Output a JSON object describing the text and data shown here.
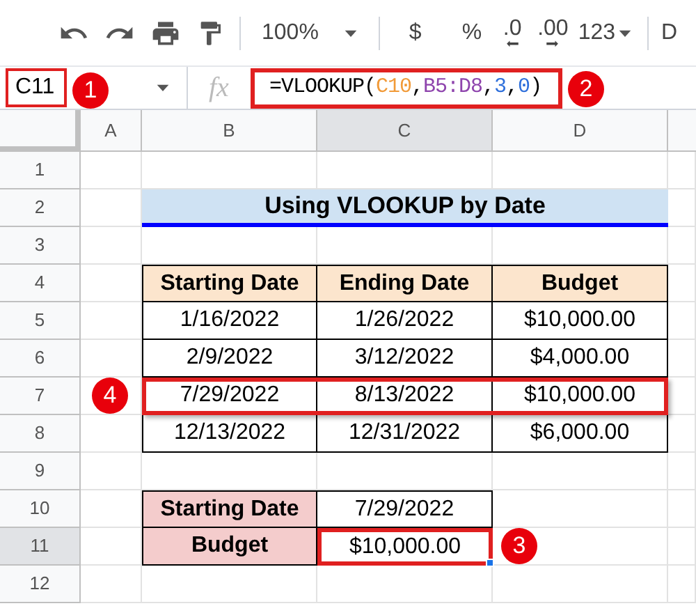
{
  "toolbar": {
    "zoom": "100%",
    "currency": "$",
    "percent": "%",
    "decrease_decimals": ".0",
    "increase_decimals": ".00",
    "more_formats": "123",
    "font": "D"
  },
  "formula_bar": {
    "name_box": "C11",
    "fx": "fx",
    "formula": [
      {
        "text": "=VLOOKUP(",
        "color": "#000000"
      },
      {
        "text": "C10",
        "color": "#f19a38"
      },
      {
        "text": ",",
        "color": "#000000"
      },
      {
        "text": "B5:D8",
        "color": "#8e44ad"
      },
      {
        "text": ",",
        "color": "#000000"
      },
      {
        "text": "3",
        "color": "#2e6fdb"
      },
      {
        "text": ",",
        "color": "#000000"
      },
      {
        "text": "0",
        "color": "#2e6fdb"
      },
      {
        "text": ")",
        "color": "#000000"
      }
    ]
  },
  "columns": [
    {
      "label": "A",
      "selected": false
    },
    {
      "label": "B",
      "selected": false
    },
    {
      "label": "C",
      "selected": true
    },
    {
      "label": "D",
      "selected": false
    }
  ],
  "rows": [
    {
      "label": "1",
      "selected": false
    },
    {
      "label": "2",
      "selected": false
    },
    {
      "label": "3",
      "selected": false
    },
    {
      "label": "4",
      "selected": false
    },
    {
      "label": "5",
      "selected": false
    },
    {
      "label": "6",
      "selected": false
    },
    {
      "label": "7",
      "selected": false
    },
    {
      "label": "8",
      "selected": false
    },
    {
      "label": "9",
      "selected": false
    },
    {
      "label": "10",
      "selected": false
    },
    {
      "label": "11",
      "selected": true
    },
    {
      "label": "12",
      "selected": false
    }
  ],
  "sheet": {
    "title": "Using VLOOKUP by Date",
    "table": {
      "columns": [
        "Starting Date",
        "Ending Date",
        "Budget"
      ],
      "rows": [
        {
          "cells": [
            "1/16/2022",
            "1/26/2022",
            "$10,000.00"
          ],
          "highlighted": false
        },
        {
          "cells": [
            "2/9/2022",
            "3/12/2022",
            "$4,000.00"
          ],
          "highlighted": false
        },
        {
          "cells": [
            "7/29/2022",
            "8/13/2022",
            "$10,000.00"
          ],
          "highlighted": true
        },
        {
          "cells": [
            "12/13/2022",
            "12/31/2022",
            "$6,000.00"
          ],
          "highlighted": false
        }
      ]
    },
    "lookup": [
      {
        "label": "Starting Date",
        "value": "7/29/2022",
        "active": false
      },
      {
        "label": "Budget",
        "value": "$10,000.00",
        "active": true
      }
    ]
  },
  "callouts": [
    "1",
    "2",
    "3",
    "4"
  ]
}
